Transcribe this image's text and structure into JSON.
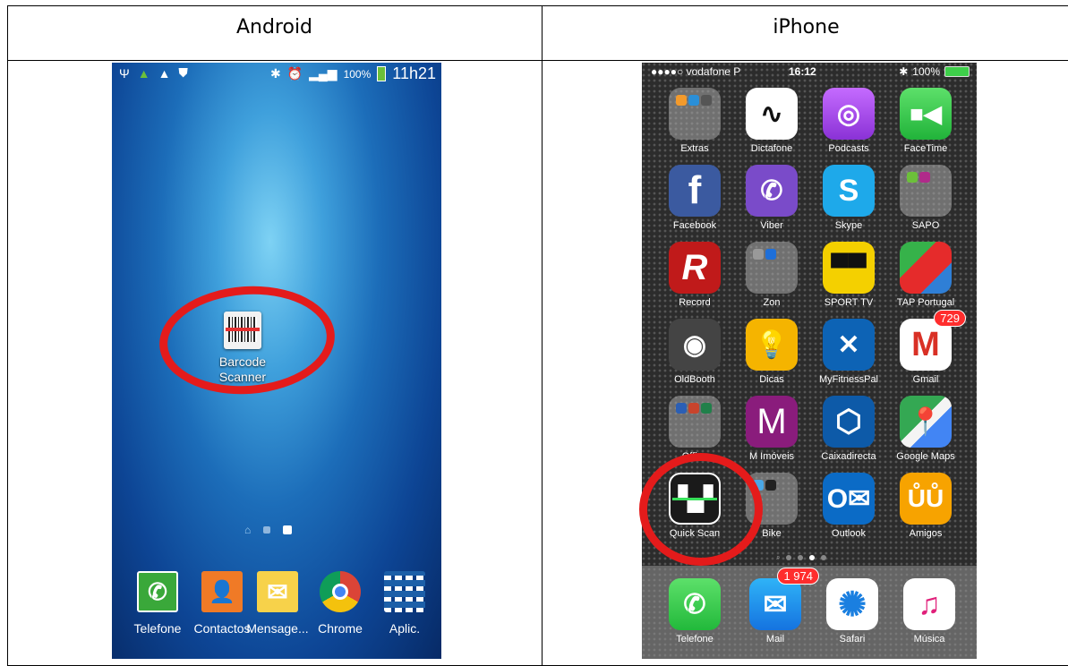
{
  "table": {
    "col_android": "Android",
    "col_iphone": "iPhone"
  },
  "android": {
    "status": {
      "battery": "100%",
      "time": "11h21"
    },
    "highlight_app": "Barcode Scanner",
    "dock": [
      {
        "label": "Telefone",
        "icon": "phone-icon"
      },
      {
        "label": "Contactos",
        "icon": "contacts-icon"
      },
      {
        "label": "Mensage...",
        "icon": "messages-icon"
      },
      {
        "label": "Chrome",
        "icon": "chrome-icon"
      },
      {
        "label": "Aplic.",
        "icon": "apps-grid-icon"
      }
    ],
    "colors": {
      "ring": "#e41b1b"
    }
  },
  "iphone": {
    "status": {
      "carrier": "●●●●○ vodafone P",
      "time": "16:12",
      "battery": "100%"
    },
    "apps": [
      {
        "label": "Extras",
        "icon": "folder-icon"
      },
      {
        "label": "Dictafone",
        "icon": "voice-memo-icon"
      },
      {
        "label": "Podcasts",
        "icon": "podcasts-icon"
      },
      {
        "label": "FaceTime",
        "icon": "facetime-icon"
      },
      {
        "label": "Facebook",
        "icon": "facebook-icon"
      },
      {
        "label": "Viber",
        "icon": "viber-icon"
      },
      {
        "label": "Skype",
        "icon": "skype-icon"
      },
      {
        "label": "SAPO",
        "icon": "folder-icon"
      },
      {
        "label": "Record",
        "icon": "record-icon"
      },
      {
        "label": "Zon",
        "icon": "folder-icon"
      },
      {
        "label": "SPORT TV",
        "icon": "sport-tv-icon"
      },
      {
        "label": "TAP Portugal",
        "icon": "tap-icon"
      },
      {
        "label": "OldBooth",
        "icon": "oldbooth-icon"
      },
      {
        "label": "Dicas",
        "icon": "lightbulb-icon"
      },
      {
        "label": "MyFitnessPal",
        "icon": "fitness-icon"
      },
      {
        "label": "Gmail",
        "icon": "gmail-icon"
      },
      {
        "label": "Office",
        "icon": "folder-icon"
      },
      {
        "label": "M Imóveis",
        "icon": "m-imoveis-icon"
      },
      {
        "label": "Caixadirecta",
        "icon": "caixa-icon"
      },
      {
        "label": "Google Maps",
        "icon": "maps-icon"
      },
      {
        "label": "Quick Scan",
        "icon": "qr-code-icon"
      },
      {
        "label": "Bike",
        "icon": "folder-icon"
      },
      {
        "label": "Outlook",
        "icon": "outlook-icon"
      },
      {
        "label": "Amigos",
        "icon": "friends-icon"
      }
    ],
    "badges": {
      "gmail": "729",
      "mail": "1 974"
    },
    "dock": [
      {
        "label": "Telefone",
        "icon": "phone-icon"
      },
      {
        "label": "Mail",
        "icon": "mail-icon"
      },
      {
        "label": "Safari",
        "icon": "safari-icon"
      },
      {
        "label": "Música",
        "icon": "music-icon"
      }
    ]
  }
}
